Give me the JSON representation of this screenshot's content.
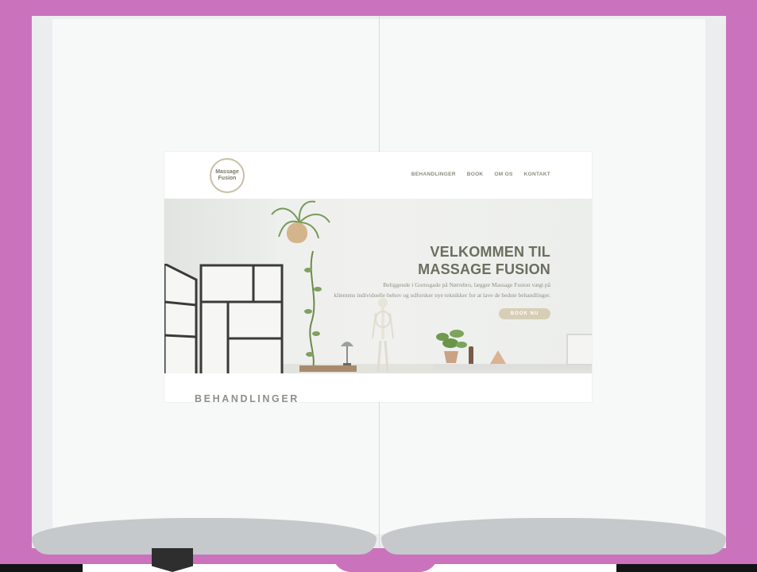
{
  "site": {
    "logo_line1": "Massage",
    "logo_line2": "Fusion",
    "nav": [
      "BEHANDLINGER",
      "BOOK",
      "OM OS",
      "KONTAKT"
    ],
    "hero": {
      "title_line1": "VELKOMMEN TIL",
      "title_line2": "MASSAGE FUSION",
      "description_line1": "Beliggende i Gornsgade på Nørrebro, lægger Massage Fusion vægt på",
      "description_line2": "klientens individuelle behov og udforsker nye teknikker for at lave de bedste behandlinger.",
      "button_label": "BOOK NU"
    },
    "section_title": "BEHANDLINGER"
  },
  "colors": {
    "book_cover": "#cb72bd",
    "page": "#f7f8f8",
    "accent_olive": "#6b6e5e",
    "button_beige": "#d6cfb6"
  }
}
